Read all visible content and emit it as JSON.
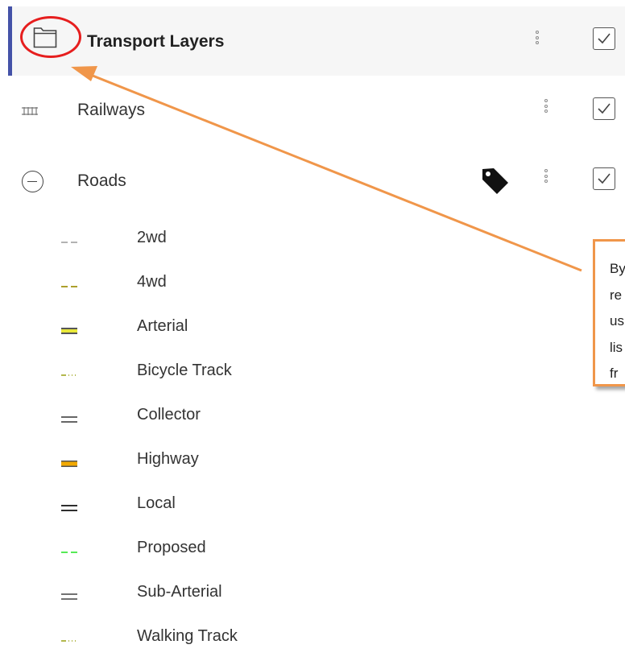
{
  "group": {
    "label": "Transport Layers",
    "checked": true,
    "icon": "folder-icon"
  },
  "layers": [
    {
      "label": "Railways",
      "icon": "railway-icon",
      "checked": true
    },
    {
      "label": "Roads",
      "icon": "collapse-icon",
      "checked": true,
      "has_label_tag": true
    }
  ],
  "legend": [
    {
      "label": "2wd",
      "symbol": "dashed",
      "color": "#9a9a9a"
    },
    {
      "label": "4wd",
      "symbol": "dashed",
      "color": "#a0920e"
    },
    {
      "label": "Arterial",
      "symbol": "double",
      "color": "#e8e83a",
      "edge": "#555"
    },
    {
      "label": "Bicycle Track",
      "symbol": "dash-dot",
      "color": "#9aa012"
    },
    {
      "label": "Collector",
      "symbol": "double",
      "color": "#ffffff",
      "edge": "#333"
    },
    {
      "label": "Highway",
      "symbol": "double",
      "color": "#f2a900",
      "edge": "#555"
    },
    {
      "label": "Local",
      "symbol": "double",
      "color": "#ffffff",
      "edge": "#111"
    },
    {
      "label": "Proposed",
      "symbol": "dashed",
      "color": "#3ee83e"
    },
    {
      "label": "Sub-Arterial",
      "symbol": "double",
      "color": "#ffffff",
      "edge": "#444"
    },
    {
      "label": "Walking Track",
      "symbol": "dash-dot",
      "color": "#9aa012"
    }
  ],
  "annotation": {
    "lines": [
      "By",
      "re",
      "us",
      "lis",
      "fr"
    ],
    "circle_color": "#e61e1e",
    "arrow_color": "#f0964a"
  }
}
